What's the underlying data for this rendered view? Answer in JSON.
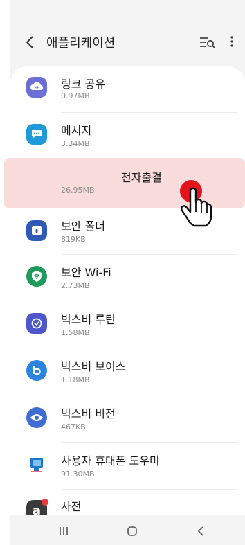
{
  "header": {
    "title": "애플리케이션",
    "back_icon": "chevron-left-icon",
    "search_icon": "list-search-icon",
    "more_icon": "more-vertical-icon"
  },
  "apps": [
    {
      "name": "링크 공유",
      "size": "0.97MB",
      "icon": "link-share-icon",
      "color": "#6b6fd6"
    },
    {
      "name": "메시지",
      "size": "3.34MB",
      "icon": "message-icon",
      "color": "#1f9ad8"
    },
    {
      "name": "전자출결",
      "size": "26.95MB",
      "icon": "",
      "color": "",
      "highlighted": true
    },
    {
      "name": "보안 폴더",
      "size": "819KB",
      "icon": "secure-folder-icon",
      "color": "#2e5ab6"
    },
    {
      "name": "보안 Wi-Fi",
      "size": "2.73MB",
      "icon": "secure-wifi-icon",
      "color": "#1e9a5a"
    },
    {
      "name": "빅스비 루틴",
      "size": "1.58MB",
      "icon": "bixby-routines-icon",
      "color": "#4d57c9"
    },
    {
      "name": "빅스비 보이스",
      "size": "1.18MB",
      "icon": "bixby-voice-icon",
      "color": "#2a84e0"
    },
    {
      "name": "빅스비 비전",
      "size": "467KB",
      "icon": "bixby-vision-icon",
      "color": "#3f6dd3"
    },
    {
      "name": "사용자 휴대폰 도우미",
      "size": "91.30MB",
      "icon": "phone-helper-icon",
      "color": "#1e76c9"
    },
    {
      "name": "사전",
      "size": "",
      "icon": "dictionary-icon",
      "color": "#3a3a3a"
    }
  ],
  "navbar": {
    "recent_icon": "recent-apps-icon",
    "home_icon": "home-icon",
    "back_icon": "back-icon"
  }
}
